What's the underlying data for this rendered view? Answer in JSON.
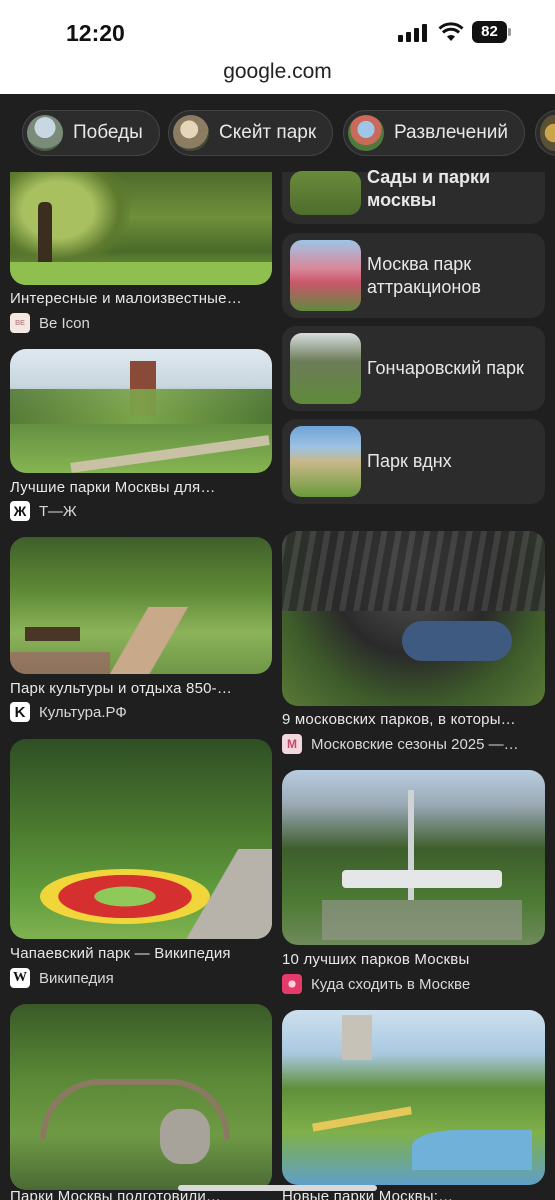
{
  "status_bar": {
    "time": "12:20",
    "battery": "82"
  },
  "browser": {
    "url": "google.com"
  },
  "chips": [
    {
      "label": "Победы"
    },
    {
      "label": "Скейт парк"
    },
    {
      "label": "Развлечений"
    }
  ],
  "related": [
    {
      "label": "Сады и парки москвы"
    },
    {
      "label": "Москва парк аттракционов"
    },
    {
      "label": "Гончаровский парк"
    },
    {
      "label": "Парк вднх"
    }
  ],
  "results": [
    {
      "title": "Интересные и малоизвестные…",
      "source": "Be Icon"
    },
    {
      "title": "Лучшие парки Москвы для…",
      "source": "Т—Ж"
    },
    {
      "title": "Парк культуры и отдыха 850-…",
      "source": "Культура.РФ"
    },
    {
      "title": "9 московских парков, в которы…",
      "source": "Московские сезоны 2025 —…"
    },
    {
      "title": "Чапаевский парк — Википедия",
      "source": "Википедия"
    },
    {
      "title": "10 лучших парков Москвы",
      "source": "Куда сходить в Москве"
    },
    {
      "title": "Парки Москвы подготовили…",
      "source": ""
    },
    {
      "title": "Новые парки Москвы:…",
      "source": ""
    }
  ]
}
